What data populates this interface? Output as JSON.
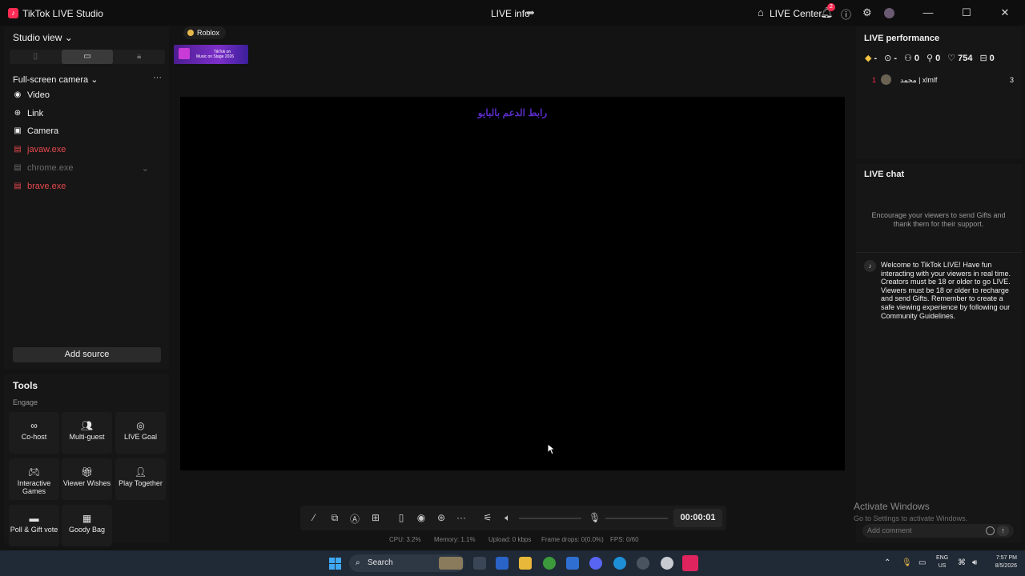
{
  "app": {
    "title": "TikTok LIVE Studio",
    "live_info": "LIVE info",
    "live_center": "LIVE Center",
    "notification_count": "2"
  },
  "left": {
    "studio_view": "Studio view",
    "scene": "Full-screen camera",
    "sources": [
      {
        "label": "Video",
        "icon": "play-circle-icon",
        "state": "normal"
      },
      {
        "label": "Link",
        "icon": "globe-icon",
        "state": "normal"
      },
      {
        "label": "Camera",
        "icon": "camera-icon",
        "state": "normal"
      },
      {
        "label": "javaw.exe",
        "icon": "window-capture-icon",
        "state": "error"
      },
      {
        "label": "chrome.exe",
        "icon": "window-capture-icon",
        "state": "disabled"
      },
      {
        "label": "brave.exe",
        "icon": "window-capture-icon",
        "state": "error"
      }
    ],
    "add_source": "Add source"
  },
  "tools": {
    "title": "Tools",
    "section": "Engage",
    "items": [
      {
        "label": "Co-host",
        "icon": "link-icon"
      },
      {
        "label": "Multi-guest",
        "icon": "users-icon"
      },
      {
        "label": "LIVE Goal",
        "icon": "target-icon"
      },
      {
        "label": "Interactive Games",
        "icon": "gamepad-icon"
      },
      {
        "label": "Viewer Wishes",
        "icon": "gift-icon"
      },
      {
        "label": "Play Together",
        "icon": "user-play-icon"
      },
      {
        "label": "Poll & Gift vote",
        "icon": "poll-icon"
      },
      {
        "label": "Goody Bag",
        "icon": "bag-icon"
      }
    ]
  },
  "stage": {
    "category": "Roblox",
    "banner_line1": "TikTok on",
    "banner_line2": "Music on Stage 2026",
    "overlay_text": "رابط الدعم بالبايو"
  },
  "controls": {
    "timer": "00:00:01"
  },
  "stats": {
    "cpu": "CPU: 3.2%",
    "memory": "Memory: 1.1%",
    "upload": "Upload: 0 kbps",
    "frame_drops": "Frame drops: 0(0.0%)",
    "fps": "FPS: 0/60"
  },
  "performance": {
    "title": "LIVE performance",
    "metrics": [
      {
        "icon": "diamond-icon",
        "value": "-"
      },
      {
        "icon": "coin-icon",
        "value": "-"
      },
      {
        "icon": "viewers-icon",
        "value": "0"
      },
      {
        "icon": "new-followers-icon",
        "value": "0"
      },
      {
        "icon": "heart-icon",
        "value": "754"
      },
      {
        "icon": "gift-box-icon",
        "value": "0"
      }
    ],
    "top_viewer": {
      "rank": "1",
      "name": "محمد | xlmlf",
      "value": "3"
    }
  },
  "chat": {
    "title": "LIVE chat",
    "encourage": "Encourage your viewers to send Gifts and thank them for their support.",
    "welcome": "Welcome to TikTok LIVE! Have fun interacting with your viewers in real time. Creators must be 18 or older to go LIVE. Viewers must be 18 or older to recharge and send Gifts. Remember to create a safe viewing experience by following our Community Guidelines.",
    "comment_placeholder": "Add comment"
  },
  "watermark": {
    "title": "Activate Windows",
    "sub": "Go to Settings to activate Windows."
  },
  "taskbar": {
    "search": "Search",
    "lang_line1": "ENG",
    "lang_line2": "US",
    "time": "7:57 PM",
    "date": "8/5/2026"
  }
}
